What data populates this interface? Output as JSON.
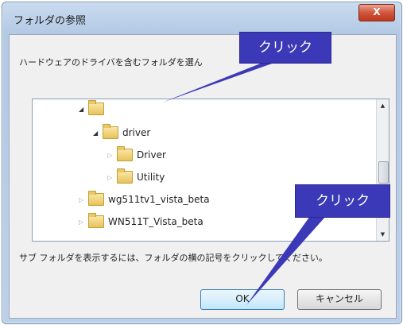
{
  "window": {
    "title": "フォルダの参照",
    "close_label": "X"
  },
  "instruction": "ハードウェアのドライバを含むフォルダを選ん",
  "tree": {
    "rows": [
      {
        "label": "",
        "level": 0,
        "expanded": true
      },
      {
        "label": "driver",
        "level": 1,
        "expanded": true
      },
      {
        "label": "Driver",
        "level": 2,
        "expanded": false
      },
      {
        "label": "Utility",
        "level": 2,
        "expanded": false
      },
      {
        "label": "wg511tv1_vista_beta",
        "level": 0,
        "expanded": false
      },
      {
        "label": "WN511T_Vista_beta",
        "level": 0,
        "expanded": false
      }
    ]
  },
  "hint": "サブ フォルダを表示するには、フォルダの横の記号をクリックしてください。",
  "buttons": {
    "ok": "OK",
    "cancel": "キャンセル"
  },
  "callouts": {
    "top": "クリック",
    "bottom": "クリック"
  },
  "colors": {
    "callout": "#3b39b7",
    "ok_border": "#3c7fb1",
    "close_button": "#c0381d"
  }
}
